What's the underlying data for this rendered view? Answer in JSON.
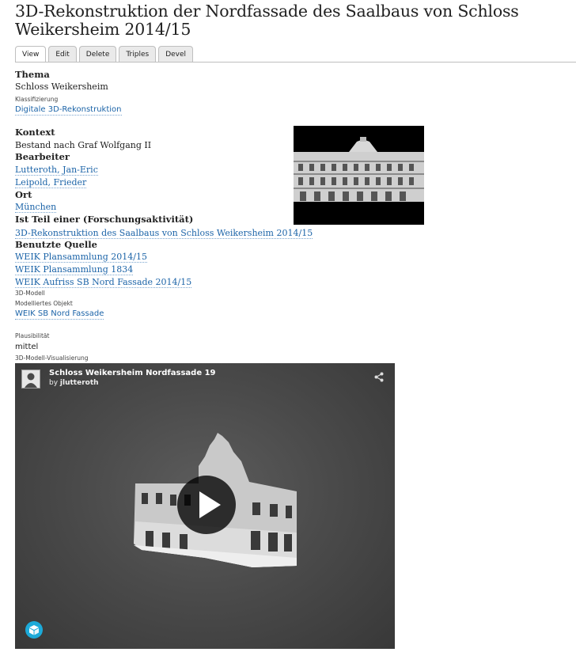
{
  "page": {
    "title": "3D-Rekonstruktion der Nordfassade des Saalbaus von Schloss Weikersheim 2014/15"
  },
  "tabs": [
    "View",
    "Edit",
    "Delete",
    "Triples",
    "Devel"
  ],
  "fields": {
    "thema_label": "Thema",
    "thema_value": "Schloss Weikersheim",
    "klassifizierung_label": "Klassifizierung",
    "klassifizierung_value": "Digitale 3D-Rekonstruktion",
    "kontext_label": "Kontext",
    "kontext_value": "Bestand nach Graf Wolfgang II",
    "bearbeiter_label": "Bearbeiter",
    "bearbeiter": [
      "Lutteroth, Jan-Eric",
      "Leipold, Frieder"
    ],
    "ort_label": "Ort",
    "ort_value": "München",
    "teil_label": "Ist Teil einer (Forschungsaktivität)",
    "teil_value": "3D-Rekonstruktion des Saalbaus von Schloss Weikersheim 2014/15",
    "quelle_label": "Benutzte Quelle",
    "quellen": [
      "WEIK Plansammlung 2014/15",
      "WEIK Plansammlung 1834",
      "WEIK Aufriss SB Nord Fassade 2014/15"
    ],
    "modell_label": "3D-Modell",
    "objekt_label": "Modelliertes Objekt",
    "objekt_value": "WEIK SB Nord Fassade",
    "plaus_label": "Plausibilität",
    "plaus_value": "mittel",
    "vis_label": "3D-Modell-Visualisierung"
  },
  "viewer": {
    "model_title": "Schloss Weikersheim Nordfassade 19",
    "by_prefix": "by",
    "author": "jlutteroth"
  },
  "colors": {
    "link": "#1c64a8",
    "sketchfab_blue": "#1caad9"
  },
  "icons": [
    "share-icon",
    "play-icon",
    "sketchfab-logo-icon",
    "avatar-icon"
  ]
}
